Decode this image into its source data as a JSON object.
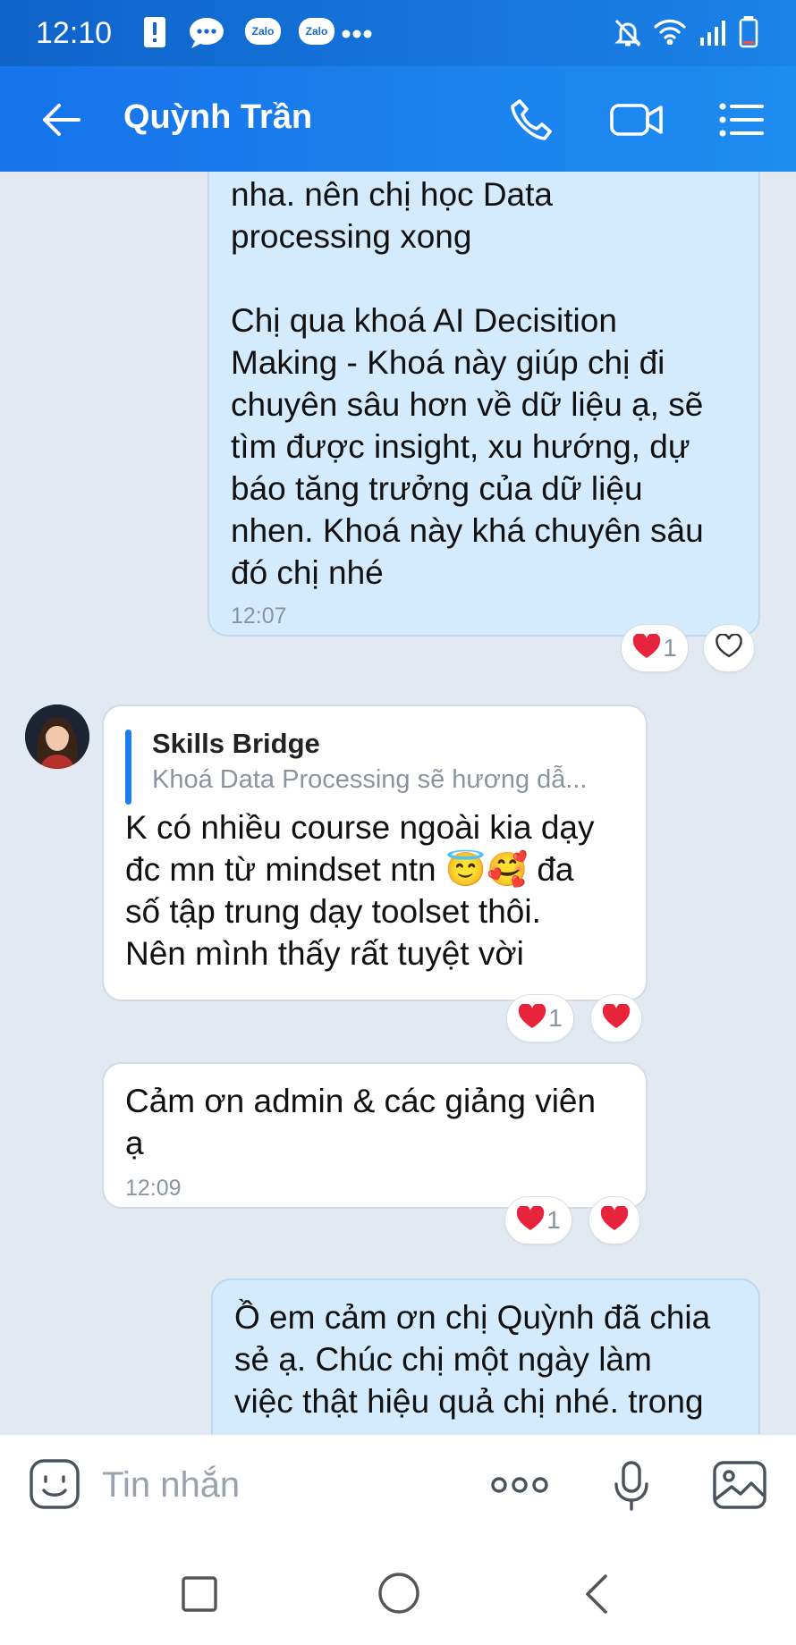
{
  "status_bar": {
    "time": "12:10",
    "app_badges": [
      "Zalo",
      "Zalo"
    ]
  },
  "header": {
    "contact_name": "Quỳnh Trần"
  },
  "messages": [
    {
      "side": "mine",
      "text": "nha. nên chị học Data\nprocessing xong\n\nChị qua khoá AI Decisition\nMaking - Khoá này giúp chị đi\nchuyên sâu hơn về dữ liệu ạ, sẽ\ntìm được insight, xu hướng, dự\nbáo tăng trưởng của dữ liệu\nnhen. Khoá này khá chuyên sâu\nđó chị nhé",
      "time": "12:07",
      "reaction_count": "1"
    },
    {
      "side": "theirs",
      "quote_title": "Skills Bridge",
      "quote_text": "Khoá Data Processing sẽ hương dẫ...",
      "text": "K có nhiều course ngoài kia dạy\nđc mn từ mindset ntn 😇🥰 đa\nsố tập trung dạy toolset thôi.\nNên mình thấy rất tuyệt vời",
      "reaction_count": "1"
    },
    {
      "side": "theirs",
      "text": "Cảm ơn admin & các giảng viên\nạ",
      "time": "12:09",
      "reaction_count": "1"
    },
    {
      "side": "mine",
      "text": "Ồ em cảm ơn chị Quỳnh đã chia\nsẻ ạ. Chúc chị một ngày làm\nviệc thật hiệu quả chị nhé. trong"
    }
  ],
  "input": {
    "placeholder": "Tin nhắn"
  },
  "colors": {
    "header": "#1a7ef0",
    "my_bubble": "#d4ebfd",
    "their_bubble": "#ffffff",
    "chat_background": "#e2e9f1",
    "heart": "#e8233c"
  },
  "icons": {
    "back": "arrow-left-icon",
    "call": "phone-icon",
    "video": "video-camera-icon",
    "menu": "list-menu-icon",
    "emoji": "sticker-icon",
    "more": "more-dots-icon",
    "mic": "microphone-icon",
    "image": "image-icon"
  }
}
